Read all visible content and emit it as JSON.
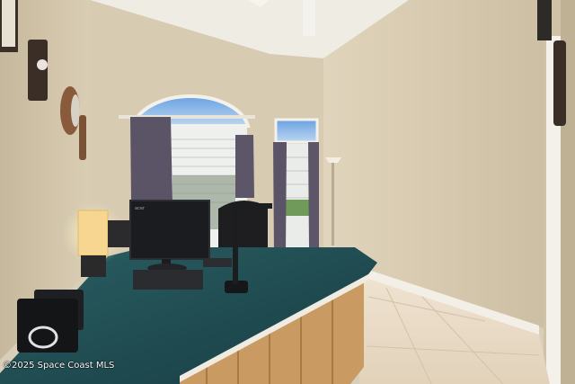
{
  "photo": {
    "watermark": "©2025 Space Coast MLS",
    "monitor_brand": "acer"
  },
  "colors": {
    "wall": "#d8ccb2",
    "ceiling": "#efece4",
    "desk_top": "#1f4f55",
    "desk_wood": "#c99a62",
    "floor": "#eadcc8",
    "curtain": "#5a5466",
    "sky": "#7fb0e6"
  }
}
